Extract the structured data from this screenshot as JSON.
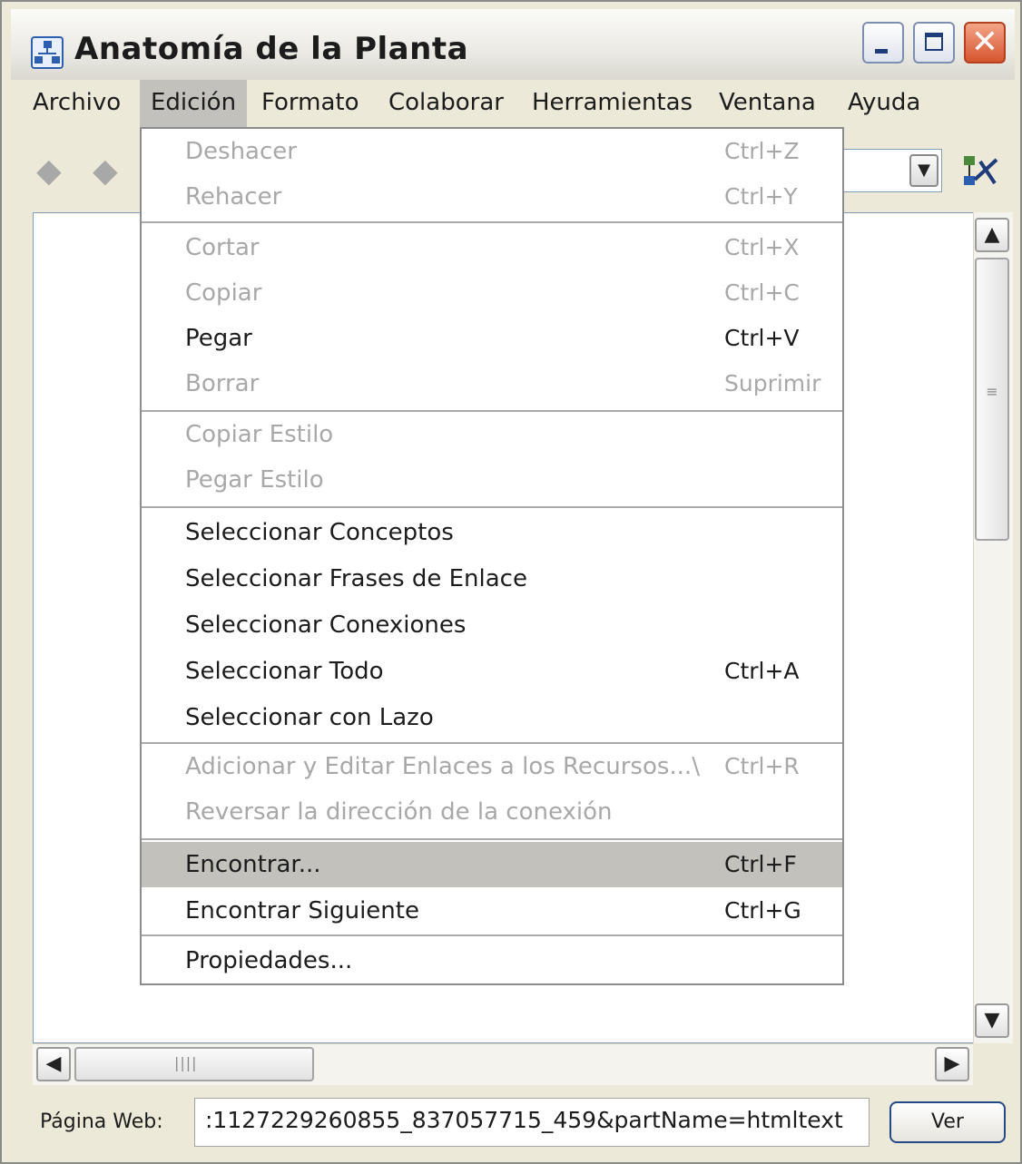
{
  "window": {
    "title": "Anatomía de la Planta",
    "close_glyph": "✕"
  },
  "menubar": {
    "archivo": "Archivo",
    "edicion": "Edición",
    "formato": "Formato",
    "colaborar": "Colaborar",
    "herramientas": "Herramientas",
    "ventana": "Ventana",
    "ayuda": "Ayuda"
  },
  "toolbar": {
    "back_glyph": "◆",
    "forward_glyph": "◆",
    "combo_arrow": "▼"
  },
  "edit_menu": {
    "items": [
      {
        "label": "Deshacer",
        "shortcut": "Ctrl+Z",
        "enabled": false
      },
      {
        "label": "Rehacer",
        "shortcut": "Ctrl+Y",
        "enabled": false
      },
      {
        "label": "Cortar",
        "shortcut": "Ctrl+X",
        "enabled": false
      },
      {
        "label": "Copiar",
        "shortcut": "Ctrl+C",
        "enabled": false
      },
      {
        "label": "Pegar",
        "shortcut": "Ctrl+V",
        "enabled": true
      },
      {
        "label": "Borrar",
        "shortcut": "Suprimir",
        "enabled": false
      },
      {
        "label": "Copiar Estilo",
        "shortcut": "",
        "enabled": false
      },
      {
        "label": "Pegar Estilo",
        "shortcut": "",
        "enabled": false
      },
      {
        "label": "Seleccionar Conceptos",
        "shortcut": "",
        "enabled": true
      },
      {
        "label": "Seleccionar Frases de Enlace",
        "shortcut": "",
        "enabled": true
      },
      {
        "label": "Seleccionar Conexiones",
        "shortcut": "",
        "enabled": true
      },
      {
        "label": "Seleccionar Todo",
        "shortcut": "Ctrl+A",
        "enabled": true
      },
      {
        "label": "Seleccionar con Lazo",
        "shortcut": "",
        "enabled": true
      },
      {
        "label": "Adicionar y Editar Enlaces a los Recursos...\\",
        "shortcut": "Ctrl+R",
        "enabled": false
      },
      {
        "label": "Reversar la dirección de la conexión",
        "shortcut": "",
        "enabled": false
      },
      {
        "label": "Encontrar...",
        "shortcut": "Ctrl+F",
        "enabled": true,
        "highlighted": true
      },
      {
        "label": "Encontrar Siguiente",
        "shortcut": "Ctrl+G",
        "enabled": true
      },
      {
        "label": "Propiedades...",
        "shortcut": "",
        "enabled": true
      }
    ]
  },
  "scrollbars": {
    "up_glyph": "▲",
    "down_glyph": "▼",
    "left_glyph": "◀",
    "right_glyph": "▶",
    "v_grip": "≡",
    "h_grip": "||||"
  },
  "statusbar": {
    "label": "Página Web:",
    "url": ":1127229260855_837057715_459&partName=htmltext",
    "button": "Ver"
  },
  "colors": {
    "menu_highlight": "#c2c1bc",
    "disabled_text": "#a8a8a8",
    "chrome": "#ece9d8"
  },
  "icons": [
    "app-icon",
    "back-arrow-icon",
    "forward-arrow-icon",
    "chevron-down-icon",
    "concept-map-tool-icon"
  ]
}
